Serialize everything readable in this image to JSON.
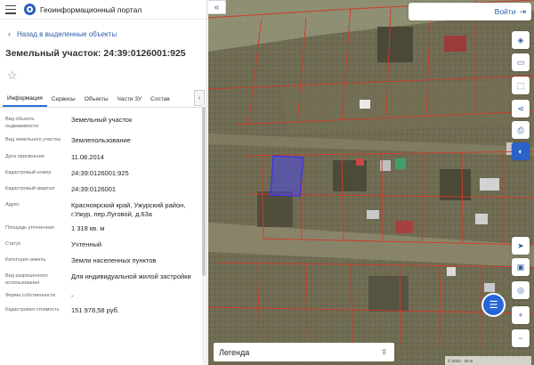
{
  "app": {
    "title": "Геоинформационный портал"
  },
  "panel": {
    "back_label": "Назад в выделенные объекты",
    "heading": "Земельный участок: 24:39:0126001:925",
    "tabs": [
      "Информация",
      "Сервисы",
      "Объекты",
      "Части ЗУ",
      "Состав"
    ],
    "tab_next": "›",
    "properties": [
      {
        "key": "Вид объекта недвижимости",
        "value": "Земельный участок"
      },
      {
        "key": "Вид земельного участка",
        "value": "Землепользование"
      },
      {
        "key": "Дата присвоения",
        "value": "11.08.2014"
      },
      {
        "key": "Кадастровый номер",
        "value": "24:39:0126001:925"
      },
      {
        "key": "Кадастровый квартал",
        "value": "24:39:0126001"
      },
      {
        "key": "Адрес",
        "value": "Красноярский край, Ужурский район, г.Ужур, пер.Луговой, д.63а"
      },
      {
        "key": "Площадь уточненная",
        "value": "1 318 кв. м"
      },
      {
        "key": "Статус",
        "value": "Учтенный"
      },
      {
        "key": "Категория земель",
        "value": "Земли населенных пунктов"
      },
      {
        "key": "Вид разрешенного использования",
        "value": "Для индивидуальной жилой застройки"
      },
      {
        "key": "Форма собственности",
        "value": "-"
      },
      {
        "key": "Кадастровая стоимость",
        "value": "151 978,58 руб."
      }
    ]
  },
  "map": {
    "collapse_label": "«",
    "login_label": "Войти",
    "legend_label": "Легенда",
    "scale_text": "© 2023 · 20 м",
    "colors": {
      "accent": "#2567d8",
      "parcel_line": "#d23a2a",
      "selected_parcel": "#4b47e0"
    }
  }
}
